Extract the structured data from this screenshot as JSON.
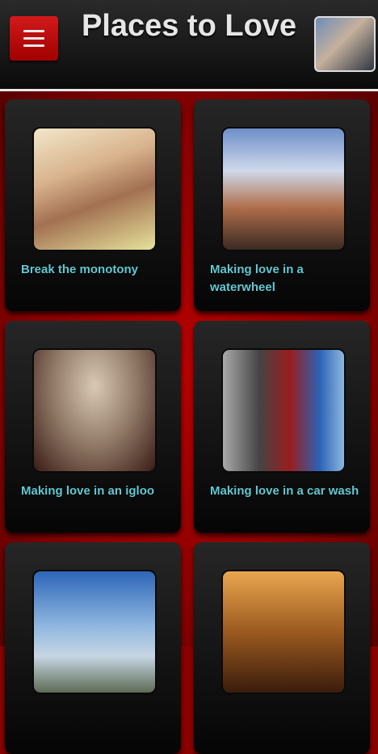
{
  "header": {
    "title": "Places to Love",
    "menu_icon": "hamburger-menu-icon",
    "profile_icon": "profile-photo"
  },
  "cards": [
    {
      "caption": "Break the monotony"
    },
    {
      "caption": "Making love in a waterwheel"
    },
    {
      "caption": "Making love in an igloo"
    },
    {
      "caption": "Making love in a car wash"
    },
    {
      "caption": ""
    },
    {
      "caption": ""
    }
  ],
  "colors": {
    "accent_red": "#b80000",
    "caption_teal": "#61c9d2",
    "title_text": "#e6e6e6"
  }
}
